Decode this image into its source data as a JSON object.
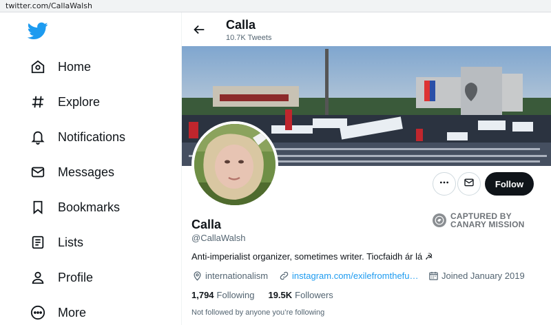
{
  "browser": {
    "url": "twitter.com/CallaWalsh"
  },
  "sidebar": {
    "logo": "twitter-bird-logo",
    "items": [
      {
        "label": "Home",
        "icon": "home-icon"
      },
      {
        "label": "Explore",
        "icon": "hashtag-icon"
      },
      {
        "label": "Notifications",
        "icon": "bell-icon"
      },
      {
        "label": "Messages",
        "icon": "envelope-icon"
      },
      {
        "label": "Bookmarks",
        "icon": "bookmark-icon"
      },
      {
        "label": "Lists",
        "icon": "list-icon"
      },
      {
        "label": "Profile",
        "icon": "person-icon"
      },
      {
        "label": "More",
        "icon": "more-circle-icon"
      }
    ]
  },
  "header": {
    "name": "Calla",
    "tweet_count": "10.7K Tweets"
  },
  "actions": {
    "follow_label": "Follow"
  },
  "stamp": {
    "line1": "CAPTURED BY",
    "line2": "CANARY MISSION"
  },
  "profile": {
    "name": "Calla",
    "handle": "@CallaWalsh",
    "bio": "Anti-imperialist organizer, sometimes writer. Tiocfaidh ár lá ☭",
    "location": "internationalism",
    "website": "instagram.com/exilefromthefu…",
    "joined": "Joined January 2019"
  },
  "stats": {
    "following_count": "1,794",
    "following_label": "Following",
    "followers_count": "19.5K",
    "followers_label": "Followers"
  },
  "followed_by": "Not followed by anyone you’re following",
  "colors": {
    "accent": "#1d9bf0",
    "text": "#0f1419",
    "secondary": "#536471",
    "follow_bg": "#0f1419"
  }
}
